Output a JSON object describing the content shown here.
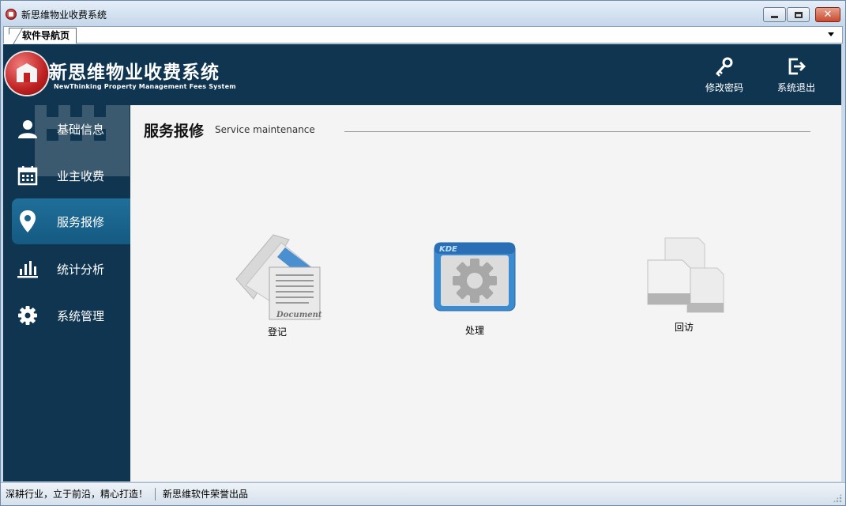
{
  "window": {
    "title": "新思维物业收费系统",
    "controls": {
      "minimize": "minimize",
      "maximize": "maximize",
      "close": "✕"
    }
  },
  "tabs": [
    {
      "label": "软件导航页"
    }
  ],
  "header": {
    "brand_cn": "新思维物业收费系统",
    "brand_en": "NewThinking  Property Management Fees System",
    "change_password_label": "修改密码",
    "exit_label": "系统退出"
  },
  "sidebar": {
    "items": [
      {
        "label": "基础信息",
        "icon": "user-icon",
        "active": false
      },
      {
        "label": "业主收费",
        "icon": "calendar-icon",
        "active": false
      },
      {
        "label": "服务报修",
        "icon": "map-pin-icon",
        "active": true
      },
      {
        "label": "统计分析",
        "icon": "bar-chart-icon",
        "active": false
      },
      {
        "label": "系统管理",
        "icon": "gear-icon",
        "active": false
      }
    ]
  },
  "main": {
    "title": "服务报修",
    "subtitle": "Service maintenance",
    "tiles": [
      {
        "label": "登记",
        "icon": "document-icon",
        "icon_text": "Document"
      },
      {
        "label": "处理",
        "icon": "settings-window-icon",
        "icon_text": "KDE"
      },
      {
        "label": "回访",
        "icon": "files-copy-icon"
      }
    ]
  },
  "statusbar": {
    "left": "深耕行业，立于前沿，精心打造！",
    "right": "新思维软件荣誉出品"
  },
  "colors": {
    "header_bg": "#0f3551",
    "active_nav": "#1f6f9a",
    "content_bg": "#f4f4f4",
    "logo_red": "#c02222"
  }
}
